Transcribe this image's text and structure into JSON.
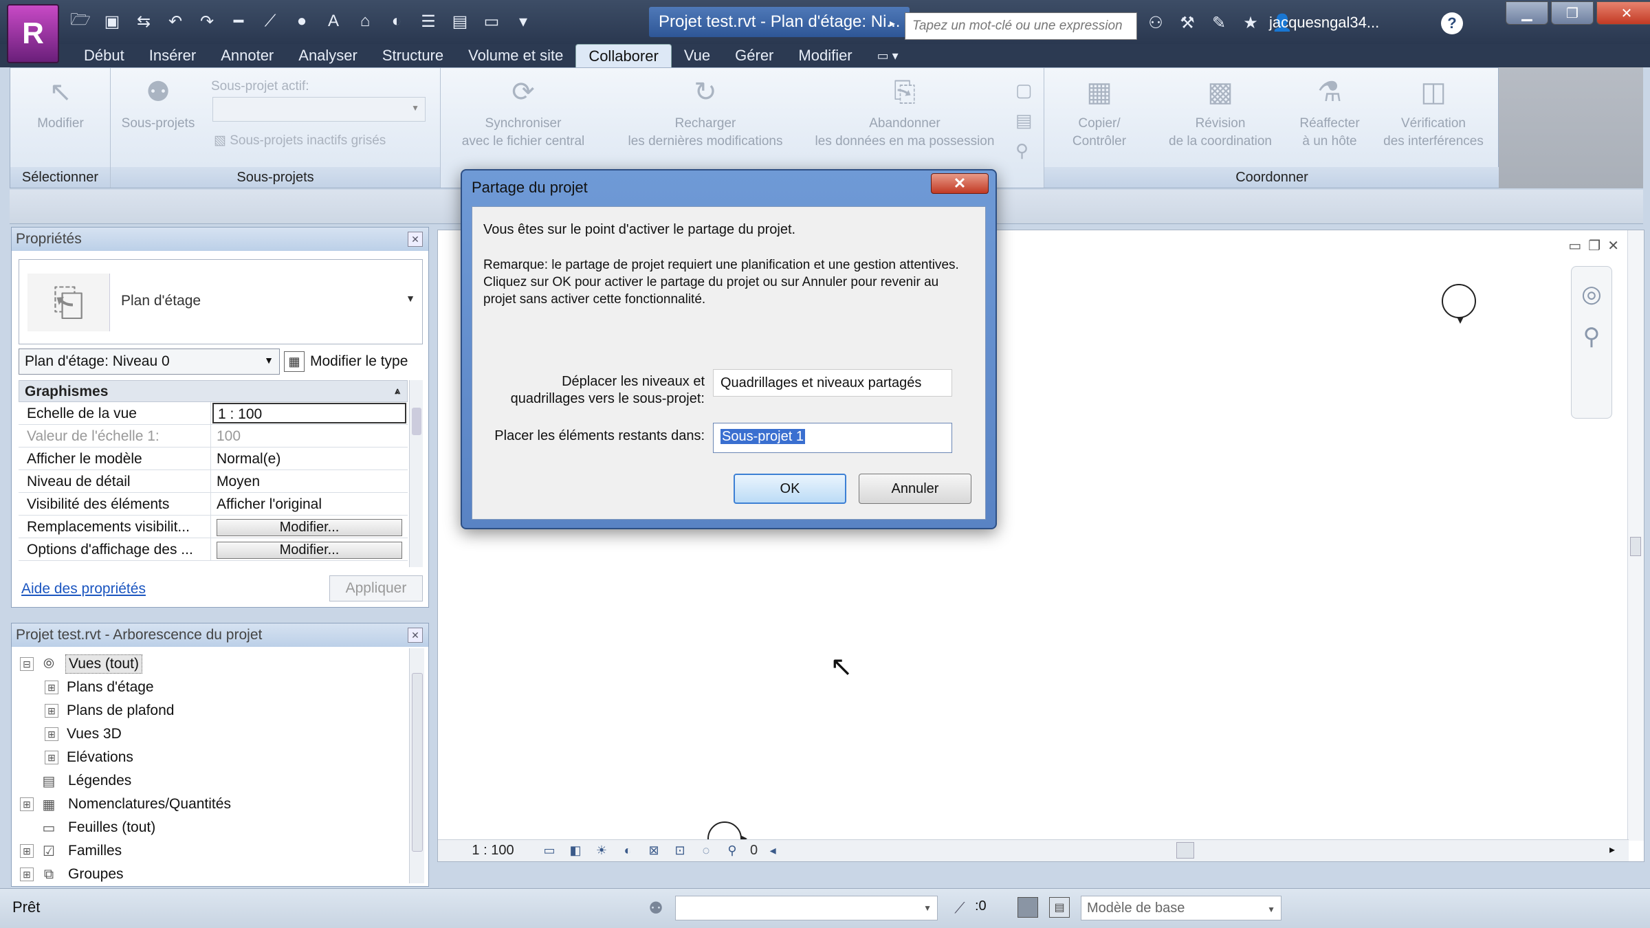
{
  "app": {
    "logo_letter": "R"
  },
  "title_bar": {
    "document_title": "Projet test.rvt - Plan d'étage: Ni...",
    "search_placeholder": "Tapez un mot-clé ou une expression",
    "user": "jacquesngal34...",
    "help": "?"
  },
  "menu": {
    "tabs": [
      "Début",
      "Insérer",
      "Annoter",
      "Analyser",
      "Structure",
      "Volume et site",
      "Collaborer",
      "Vue",
      "Gérer",
      "Modifier"
    ],
    "active_tab": "Collaborer",
    "extra": "▭ ▾"
  },
  "ribbon": {
    "groups": {
      "select": {
        "title": "Sélectionner",
        "modify": "Modifier"
      },
      "worksets": {
        "title": "Sous-projets",
        "worksets_btn": "Sous-projets",
        "active_label": "Sous-projet actif:",
        "gray_inactive": "Sous-projets inactifs grisés"
      },
      "sync": {
        "synchronize_l1": "Synchroniser",
        "synchronize_l2": "avec le fichier central",
        "reload_l1": "Recharger",
        "reload_l2": "les dernières modifications",
        "relinquish_l1": "Abandonner",
        "relinquish_l2": "les données en ma possession"
      },
      "coordinate": {
        "title": "Coordonner",
        "copy_l1": "Copier/",
        "copy_l2": "Contrôler",
        "review_l1": "Révision",
        "review_l2": "de la coordination",
        "reconcile_l1": "Réaffecter",
        "reconcile_l2": "à un hôte",
        "interference_l1": "Vérification",
        "interference_l2": "des interférences"
      }
    }
  },
  "properties": {
    "header": "Propriétés",
    "type_name": "Plan d'étage",
    "view_selector": "Plan d'étage: Niveau 0",
    "edit_type": "Modifier le type",
    "group_header": "Graphismes",
    "rows": [
      {
        "key": "Echelle de la vue",
        "value": "1 : 100"
      },
      {
        "key": "Valeur de l'échelle    1:",
        "value": "100"
      },
      {
        "key": "Afficher le modèle",
        "value": "Normal(e)"
      },
      {
        "key": "Niveau de détail",
        "value": "Moyen"
      },
      {
        "key": "Visibilité des éléments",
        "value": "Afficher l'original"
      },
      {
        "key": "Remplacements visibilit...",
        "value": "Modifier..."
      },
      {
        "key": "Options d'affichage des ...",
        "value": "Modifier..."
      }
    ],
    "help_link": "Aide des propriétés",
    "apply": "Appliquer"
  },
  "browser": {
    "header": "Projet test.rvt - Arborescence du projet",
    "nodes": [
      {
        "label": "Vues (tout)",
        "toggle": "⊟"
      },
      {
        "label": "Plans d'étage",
        "toggle": "⊞"
      },
      {
        "label": "Plans de plafond",
        "toggle": "⊞"
      },
      {
        "label": "Vues 3D",
        "toggle": "⊞"
      },
      {
        "label": "Elévations",
        "toggle": "⊞"
      },
      {
        "label": "Légendes",
        "toggle": ""
      },
      {
        "label": "Nomenclatures/Quantités",
        "toggle": "⊞"
      },
      {
        "label": "Feuilles (tout)",
        "toggle": ""
      },
      {
        "label": "Familles",
        "toggle": "⊞"
      },
      {
        "label": "Groupes",
        "toggle": "⊞"
      }
    ]
  },
  "view_control": {
    "scale": "1 : 100",
    "count": "0"
  },
  "status": {
    "text": "Prêt",
    "selection_count": ":0",
    "design_option": "Modèle de base"
  },
  "dialog": {
    "title": "Partage du projet",
    "close": "✕",
    "message1": "Vous êtes sur le point d'activer le partage du projet.",
    "message2": "Remarque: le partage de projet requiert une planification et une gestion attentives. Cliquez sur OK pour activer le partage du projet ou sur Annuler pour revenir au projet sans activer cette fonctionnalité.",
    "label_move": "Déplacer les niveaux et quadrillages vers le sous-projet:",
    "value_move": "Quadrillages et niveaux partagés",
    "label_place": "Placer les éléments restants dans:",
    "value_place": "Sous-projet 1",
    "ok": "OK",
    "cancel": "Annuler"
  }
}
